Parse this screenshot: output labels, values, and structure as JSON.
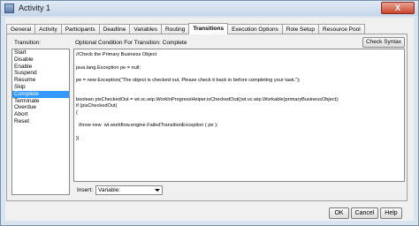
{
  "window": {
    "title": "Activity 1",
    "close_label": "X"
  },
  "tabs": [
    {
      "label": "General"
    },
    {
      "label": "Activity"
    },
    {
      "label": "Participants"
    },
    {
      "label": "Deadline"
    },
    {
      "label": "Variables"
    },
    {
      "label": "Routing"
    },
    {
      "label": "Transitions",
      "active": true
    },
    {
      "label": "Execution Options"
    },
    {
      "label": "Role Setup"
    },
    {
      "label": "Resource Pool"
    }
  ],
  "transition_label": "Transition:",
  "transitions": [
    {
      "label": "Start"
    },
    {
      "label": "Disable"
    },
    {
      "label": "Enable"
    },
    {
      "label": "Suspend"
    },
    {
      "label": "Resume"
    },
    {
      "label": "Skip"
    },
    {
      "label": "Complete",
      "selected": true
    },
    {
      "label": "Terminate"
    },
    {
      "label": "Overdue"
    },
    {
      "label": "Abort"
    },
    {
      "label": "Reset"
    }
  ],
  "condition_label": "Optional Condition For Transition: Complete",
  "check_syntax_label": "Check Syntax",
  "code_lines": [
    "//Check the Primary Business Object",
    "",
    "java.lang.Exception pe = null;",
    "",
    "pe = new Exception(\"The object is checked out. Please check it back in before completing your task.\");",
    "",
    "",
    "boolean pisCheckedOut = wt.vc.wip.WorkInProgressHelper.isCheckedOut((wt.vc.wip.Workable)primaryBusinessObject);",
    "if (pisCheckedOut)",
    "{",
    "",
    "  throw new  wt.workflow.engine.FailedTransitionException ( pe );",
    "",
    "}|"
  ],
  "insert": {
    "label": "Insert:",
    "value": "Variable:"
  },
  "buttons": {
    "ok": "OK",
    "cancel": "Cancel",
    "help": "Help"
  }
}
